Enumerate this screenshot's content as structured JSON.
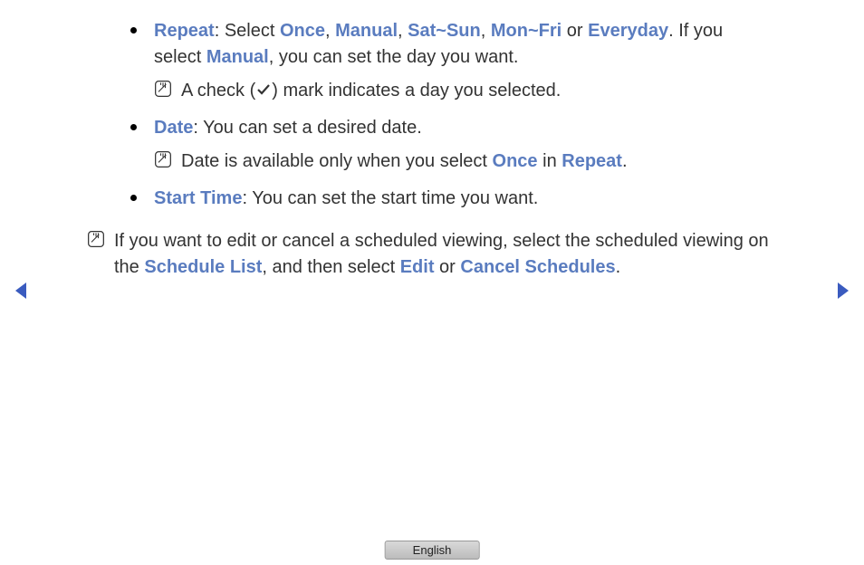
{
  "bullets": {
    "repeat": {
      "label": "Repeat",
      "text1": ": Select ",
      "opt1": "Once",
      "sep1": ", ",
      "opt2": "Manual",
      "sep2": ", ",
      "opt3": "Sat~Sun",
      "sep3": ", ",
      "opt4": "Mon~Fri",
      "sep4": " or ",
      "opt5": "Everyday",
      "text2": ". If you select ",
      "opt6": "Manual",
      "text3": ", you can set the day you want."
    },
    "repeat_note_pre": "A check (",
    "repeat_note_post": ") mark indicates a day you selected.",
    "date": {
      "label": "Date",
      "text": ": You can set a desired date."
    },
    "date_note": {
      "pre": "Date is available only when you select ",
      "kw1": "Once",
      "mid": " in ",
      "kw2": "Repeat",
      "post": "."
    },
    "start": {
      "label": "Start Time",
      "text": ": You can set the start time you want."
    }
  },
  "main_note": {
    "pre": "If you want to edit or cancel a scheduled viewing, select the scheduled viewing on the ",
    "kw1": "Schedule List",
    "mid": ", and then select ",
    "kw2": "Edit",
    "mid2": " or ",
    "kw3": "Cancel Schedules",
    "post": "."
  },
  "footer": {
    "lang": "English"
  }
}
